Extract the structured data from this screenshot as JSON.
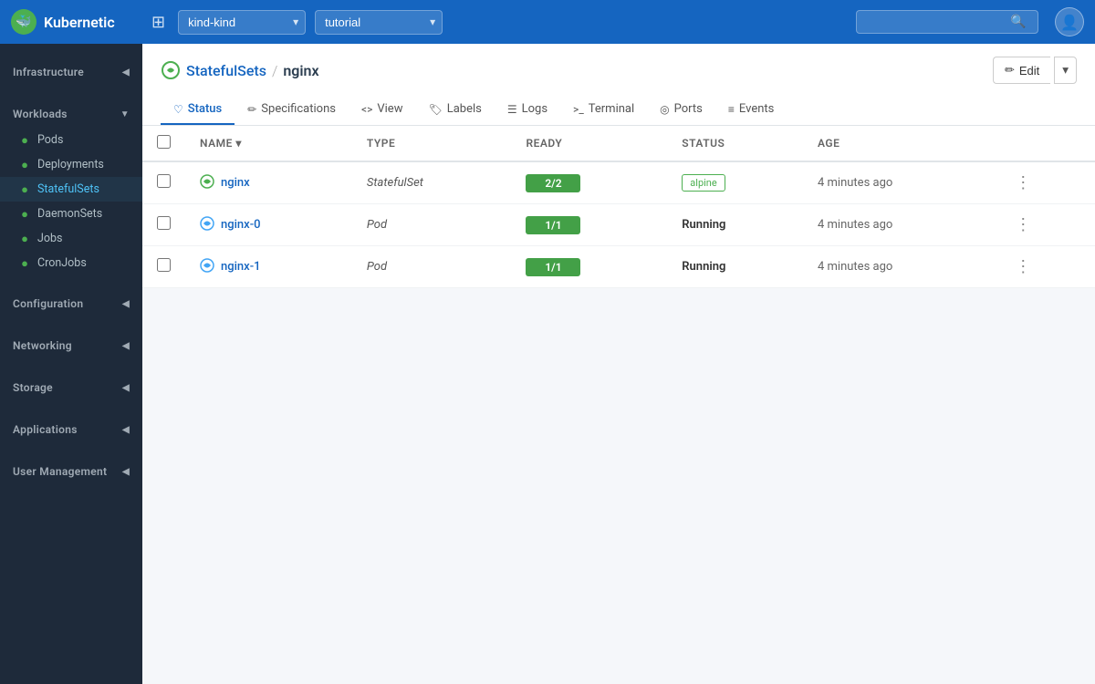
{
  "app": {
    "name": "Kubernetic"
  },
  "navbar": {
    "cluster_placeholder": "kind-kind",
    "namespace_placeholder": "tutorial",
    "search_placeholder": "",
    "grid_icon": "⊞",
    "user_icon": "👤"
  },
  "sidebar": {
    "groups": [
      {
        "label": "Infrastructure",
        "id": "infrastructure",
        "expanded": false,
        "items": []
      },
      {
        "label": "Workloads",
        "id": "workloads",
        "expanded": true,
        "items": [
          {
            "label": "Pods",
            "id": "pods",
            "active": false
          },
          {
            "label": "Deployments",
            "id": "deployments",
            "active": false
          },
          {
            "label": "StatefulSets",
            "id": "statefulsets",
            "active": true
          },
          {
            "label": "DaemonSets",
            "id": "daemonsets",
            "active": false
          },
          {
            "label": "Jobs",
            "id": "jobs",
            "active": false
          },
          {
            "label": "CronJobs",
            "id": "cronjobs",
            "active": false
          }
        ]
      },
      {
        "label": "Configuration",
        "id": "configuration",
        "expanded": false,
        "items": []
      },
      {
        "label": "Networking",
        "id": "networking",
        "expanded": false,
        "items": []
      },
      {
        "label": "Storage",
        "id": "storage",
        "expanded": false,
        "items": []
      },
      {
        "label": "Applications",
        "id": "applications",
        "expanded": false,
        "items": []
      },
      {
        "label": "User Management",
        "id": "user-management",
        "expanded": false,
        "items": []
      }
    ]
  },
  "page": {
    "breadcrumb_parent": "StatefulSets",
    "breadcrumb_child": "nginx",
    "edit_label": "Edit",
    "tabs": [
      {
        "id": "status",
        "label": "Status",
        "icon": "♡",
        "active": true
      },
      {
        "id": "specifications",
        "label": "Specifications",
        "icon": "✏",
        "active": false
      },
      {
        "id": "view",
        "label": "View",
        "icon": "<>",
        "active": false
      },
      {
        "id": "labels",
        "label": "Labels",
        "icon": "🏷",
        "active": false
      },
      {
        "id": "logs",
        "label": "Logs",
        "icon": "☰",
        "active": false
      },
      {
        "id": "terminal",
        "label": "Terminal",
        "icon": ">_",
        "active": false
      },
      {
        "id": "ports",
        "label": "Ports",
        "icon": "◎",
        "active": false
      },
      {
        "id": "events",
        "label": "Events",
        "icon": "≡",
        "active": false
      }
    ],
    "table": {
      "columns": [
        "NAME",
        "TYPE",
        "READY",
        "STATUS",
        "AGE"
      ],
      "rows": [
        {
          "name": "nginx",
          "type": "StatefulSet",
          "ready": "2/2",
          "status": "alpine",
          "status_type": "badge",
          "age": "4 minutes ago",
          "icon_color": "green"
        },
        {
          "name": "nginx-0",
          "type": "Pod",
          "ready": "1/1",
          "status": "Running",
          "status_type": "text",
          "age": "4 minutes ago",
          "icon_color": "blue"
        },
        {
          "name": "nginx-1",
          "type": "Pod",
          "ready": "1/1",
          "status": "Running",
          "status_type": "text",
          "age": "4 minutes ago",
          "icon_color": "blue"
        }
      ]
    }
  }
}
